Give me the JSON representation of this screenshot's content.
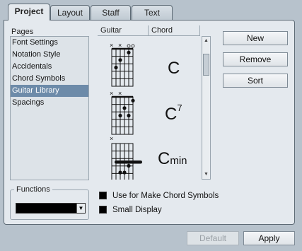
{
  "tabs": [
    {
      "label": "Project",
      "active": true
    },
    {
      "label": "Layout",
      "active": false
    },
    {
      "label": "Staff",
      "active": false
    },
    {
      "label": "Text",
      "active": false
    }
  ],
  "pages": {
    "header": "Pages",
    "items": [
      {
        "label": "Font Settings",
        "selected": false
      },
      {
        "label": "Notation Style",
        "selected": false
      },
      {
        "label": "Accidentals",
        "selected": false
      },
      {
        "label": "Chord Symbols",
        "selected": false
      },
      {
        "label": "Guitar Library",
        "selected": true
      },
      {
        "label": "Spacings",
        "selected": false
      }
    ]
  },
  "functions": {
    "label": "Functions",
    "selected_value": ""
  },
  "library": {
    "columns": [
      "Guitar",
      "Chord"
    ],
    "chords": [
      {
        "root": "C",
        "suffix": "",
        "superscript": ""
      },
      {
        "root": "C",
        "suffix": "",
        "superscript": "7"
      },
      {
        "root": "C",
        "suffix": "min",
        "superscript": ""
      }
    ]
  },
  "buttons": {
    "new": "New",
    "remove": "Remove",
    "sort": "Sort",
    "default": "Default",
    "apply": "Apply"
  },
  "options": [
    {
      "label": "Use for Make Chord Symbols",
      "checked": false
    },
    {
      "label": "Small Display",
      "checked": false
    }
  ],
  "colors": {
    "background": "#b7c2cc",
    "panel": "#e4e9ee",
    "selection": "#6d8ba9"
  },
  "icons": {
    "scroll_up": "triangle-up",
    "scroll_down": "triangle-down",
    "dropdown": "triangle-down"
  }
}
